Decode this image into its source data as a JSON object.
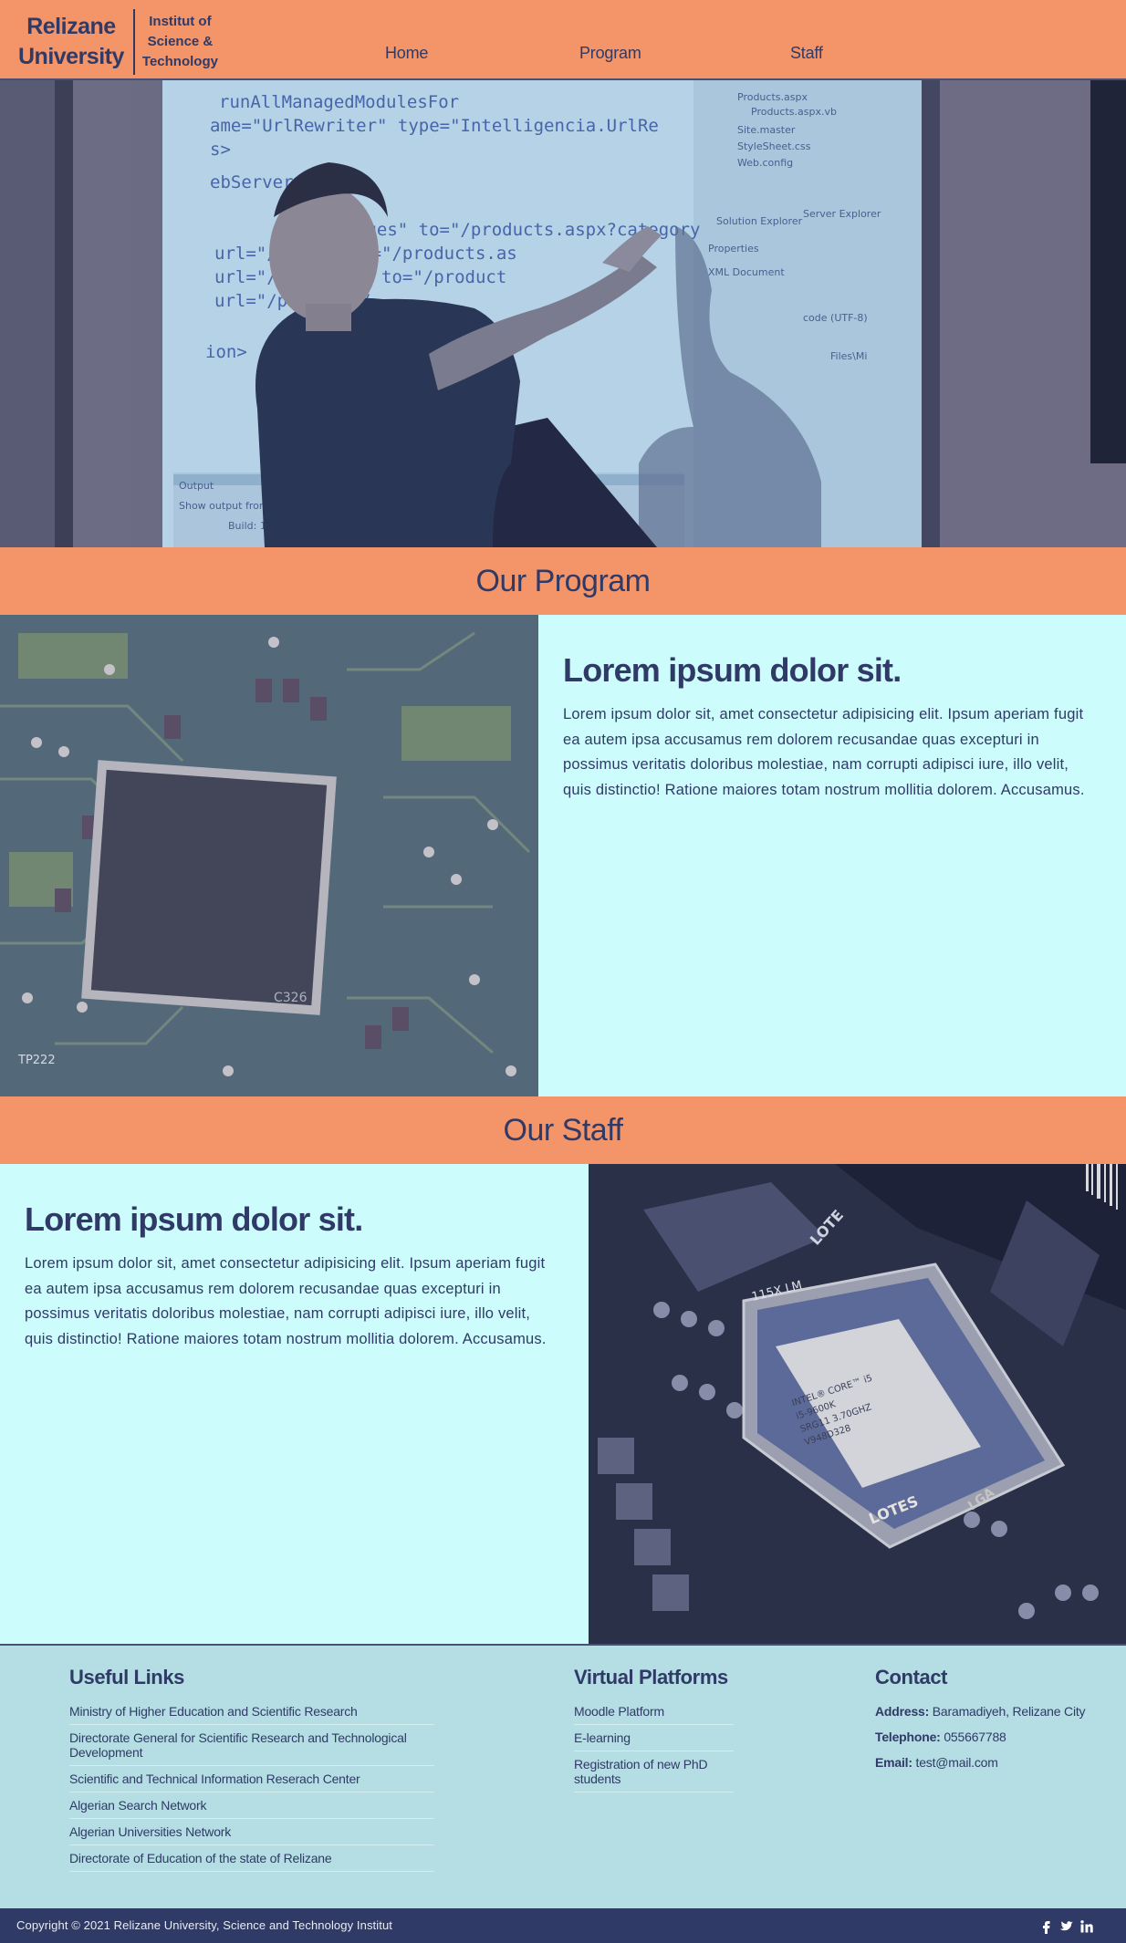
{
  "brand": {
    "name_line1": "Relizane",
    "name_line2": "University",
    "sub_line1": "Institut of",
    "sub_line2": "Science &",
    "sub_line3": "Technology"
  },
  "nav": {
    "home": "Home",
    "program": "Program",
    "staff": "Staff"
  },
  "program": {
    "title": "Our Program",
    "heading": "Lorem ipsum dolor sit.",
    "body": "Lorem ipsum dolor sit, amet consectetur adipisicing elit. Ipsum aperiam fugit ea autem ipsa accusamus rem dolorem recusandae quas excepturi in possimus veritatis doloribus molestiae, nam corrupti adipisci iure, illo velit, quis distinctio! Ratione maiores totam nostrum mollitia dolorem. Accusamus."
  },
  "staff": {
    "title": "Our Staff",
    "heading": "Lorem ipsum dolor sit.",
    "body": "Lorem ipsum dolor sit, amet consectetur adipisicing elit. Ipsum aperiam fugit ea autem ipsa accusamus rem dolorem recusandae quas excepturi in possimus veritatis doloribus molestiae, nam corrupti adipisci iure, illo velit, quis distinctio! Ratione maiores totam nostrum mollitia dolorem. Accusamus."
  },
  "hero_code": {
    "line1": "runAllManagedModulesFor",
    "line2": "ame=\"UrlRewriter\" type=\"Intelligencia.UrlRe",
    "line3": "s>",
    "line4": "ebServer>",
    "line5": "ages\" to=\"/products.aspx?category",
    "line6": "url=\"/ments\" to=\"/products.as",
    "line7": "url=\"/products\" to=\"/product",
    "line8": "url=\"/products/",
    "line9": "ion>",
    "panel1": "Products.aspx",
    "panel2": "Products.aspx.vb",
    "panel3": "Site.master",
    "panel4": "StyleSheet.css",
    "panel5": "Web.config",
    "panel6": "Solution Explorer",
    "panel7": "Server Explorer",
    "panel8": "Properties",
    "panel9": "XML Document",
    "panel10": "code (UTF-8)",
    "panel11": "Files\\Mi",
    "output1": "Output",
    "output2": "Show output from:",
    "output3": "Build: 1"
  },
  "board1": {
    "label1": "TP222",
    "label2": "C326"
  },
  "cpu": {
    "socket_label": "115X LM",
    "line1": "INTEL® CORE™ i5",
    "line2": "i5-9600K",
    "line3": "SRG11 3.70GHZ",
    "line4": "V948D328",
    "deco1": "LGA",
    "deco2": "LOTES",
    "deco3": "LOTE"
  },
  "footer": {
    "useful": {
      "title": "Useful Links",
      "links": [
        "Ministry of Higher Education and Scientific Research",
        "Directorate General for Scientific Research and Technological Development",
        "Scientific and Technical Information Reserach Center",
        "Algerian Search Network",
        "Algerian Universities Network",
        "Directorate of Education of the state of Relizane"
      ]
    },
    "virtual": {
      "title": "Virtual Platforms",
      "links": [
        "Moodle Platform",
        "E-learning",
        "Registration of new PhD students"
      ]
    },
    "contact": {
      "title": "Contact",
      "address_label": "Address:",
      "address": "Baramadiyeh, Relizane City",
      "phone_label": "Telephone:",
      "phone": "055667788",
      "email_label": "Email:",
      "email": "test@mail.com"
    }
  },
  "copyright": "Copyright © 2021 Relizane University, Science and Technology Institut",
  "social": [
    "facebook-icon",
    "twitter-icon",
    "linkedin-icon"
  ],
  "colors": {
    "accent": "#f39469",
    "navy": "#2f3a66",
    "pane": "#ccfcfc",
    "footer": "#b4dee3"
  }
}
